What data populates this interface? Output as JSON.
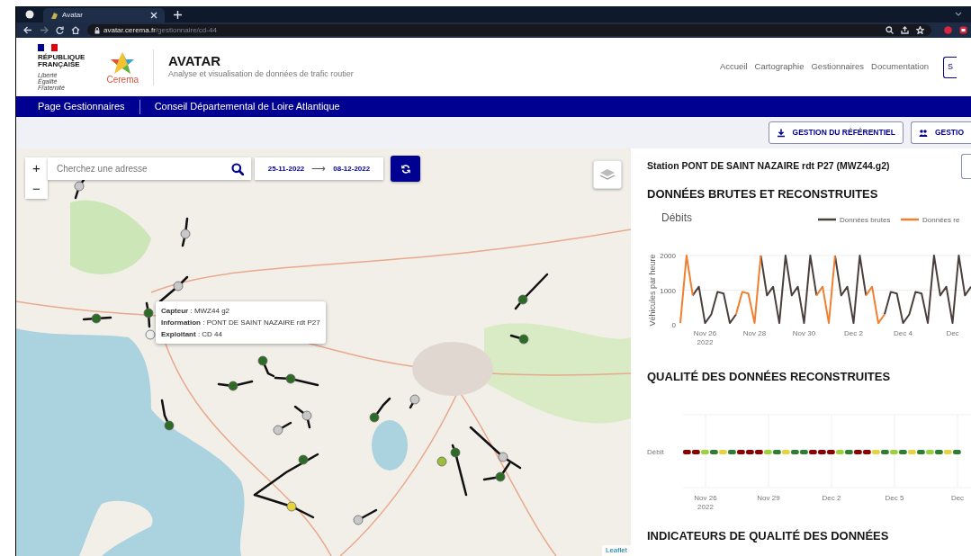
{
  "browser": {
    "tab_title": "Avatar",
    "url_host": "avatar.cerema.fr",
    "url_path": "/gestionnaire/cd-44"
  },
  "header": {
    "logo_lines": [
      "RÉPUBLIQUE",
      "FRANÇAISE"
    ],
    "motto": [
      "Liberté",
      "Égalité",
      "Fraternité"
    ],
    "partner": "Cerema",
    "title": "AVATAR",
    "subtitle": "Analyse et visualisation de données de trafic routier",
    "nav": [
      "Accueil",
      "Cartographie",
      "Gestionnaires",
      "Documentation"
    ],
    "nav_button": "S"
  },
  "breadcrumb": [
    "Page Gestionnaires",
    "Conseil Départemental de Loire Atlantique"
  ],
  "toolbar": [
    {
      "label": "GESTION DU RÉFÉRENTIEL",
      "kind": "download"
    },
    {
      "label": "GESTIO",
      "kind": "users"
    }
  ],
  "map": {
    "zoom_in": "+",
    "zoom_out": "−",
    "search_placeholder": "Cherchez une adresse",
    "date_from": "25-11-2022",
    "date_arrow": "⟶",
    "date_to": "08-12-2022",
    "tooltip": [
      "**Capteur** : MWZ44 g2",
      "**Information** : PONT DE SAINT NAZAIRE rdt P27",
      "**Exploitant** : CD 44"
    ],
    "attribution": "Leaflet",
    "sensors": [
      {
        "color": "#c8c8c8"
      },
      {
        "color": "#c8c8c8"
      },
      {
        "color": "#c8c8c8"
      },
      {
        "color": "#2e6b27"
      },
      {
        "color": "#2e6b27"
      },
      {
        "color": "#eeeeee"
      },
      {
        "color": "#2e6b27"
      },
      {
        "color": "#2e6b27"
      },
      {
        "color": "#2e6b27"
      },
      {
        "color": "#2e6b27"
      },
      {
        "color": "#c8c8c8"
      },
      {
        "color": "#c8c8c8"
      },
      {
        "color": "#2e6b27"
      },
      {
        "color": "#c8c8c8"
      },
      {
        "color": "#2e6b27"
      },
      {
        "color": "#e6d33f"
      },
      {
        "color": "#c8c8c8"
      },
      {
        "color": "#9bbf3a"
      },
      {
        "color": "#2e6b27"
      },
      {
        "color": "#c8c8c8"
      },
      {
        "color": "#2e6b27"
      },
      {
        "color": "#2e6b27"
      },
      {
        "color": "#2e6b27"
      }
    ]
  },
  "station": {
    "title": "Station PONT DE SAINT NAZAIRE rdt P27 (MWZ44.g2)",
    "section_1": "DONNÉES BRUTES ET RECONSTRUITES",
    "chart_data": {
      "type": "line",
      "title": "Débits",
      "ylabel": "Véhicules par heure",
      "categories": [
        null,
        null,
        null,
        null,
        "Nov 26\n2022",
        null,
        null,
        null,
        null,
        null,
        null,
        null,
        "Nov 28",
        null,
        null,
        null,
        null,
        null,
        null,
        null,
        "Nov 30",
        null,
        null,
        null,
        null,
        null,
        null,
        null,
        "Dec 2",
        null,
        null,
        null,
        null,
        null,
        null,
        null,
        "Dec 4",
        null,
        null,
        null,
        null,
        null,
        null,
        null,
        "Dec",
        null,
        null,
        null
      ],
      "series": [
        {
          "name": "Données brutes",
          "color": "#4a3f3c",
          "values": [
            null,
            null,
            850,
            1100,
            50,
            300,
            950,
            900,
            50,
            300,
            null,
            null,
            null,
            2000,
            850,
            1100,
            50,
            2000,
            850,
            1100,
            50,
            2000,
            850,
            null,
            null,
            2000,
            850,
            1100,
            50,
            2000,
            850,
            null,
            null,
            300,
            950,
            900,
            50,
            300,
            950,
            900,
            50,
            2000,
            850,
            1100,
            50,
            2000,
            850,
            1100
          ]
        },
        {
          "name": "Données re",
          "color": "#f07f30",
          "values": [
            50,
            2000,
            850,
            null,
            null,
            null,
            null,
            null,
            null,
            300,
            950,
            900,
            50,
            2000,
            null,
            null,
            null,
            null,
            null,
            null,
            null,
            null,
            850,
            1100,
            50,
            2000,
            null,
            null,
            null,
            null,
            850,
            1100,
            50,
            300,
            null,
            null,
            null,
            null,
            null,
            null,
            null,
            null,
            null,
            null,
            null,
            null,
            null,
            null
          ]
        }
      ],
      "legend": "top-right",
      "ylim": [
        0,
        2000
      ],
      "yticks": [
        0,
        1000,
        2000
      ]
    },
    "section_2": "QUALITÉ DES DONNÉES RECONSTRUITES",
    "quality": {
      "row_label": "Débit",
      "x_labels": [
        "Nov 26\n2022",
        "Nov 29",
        "Dec 2",
        "Dec 5",
        "Dec"
      ],
      "segments": [
        {
          "color": "#8b0000"
        },
        {
          "color": "#8b0000"
        },
        {
          "color": "#9bd13a"
        },
        {
          "color": "#2e7d32"
        },
        {
          "color": "#e6d33f"
        },
        {
          "color": "#2e7d32"
        },
        {
          "color": "#8b0000"
        },
        {
          "color": "#8b0000"
        },
        {
          "color": "#8b0000"
        },
        {
          "color": "#9bd13a"
        },
        {
          "color": "#2e7d32"
        },
        {
          "color": "#e6d33f"
        },
        {
          "color": "#2e7d32"
        },
        {
          "color": "#2e7d32"
        },
        {
          "color": "#8b0000"
        },
        {
          "color": "#8b0000"
        },
        {
          "color": "#8b0000"
        },
        {
          "color": "#9bd13a"
        },
        {
          "color": "#2e7d32"
        },
        {
          "color": "#8b0000"
        },
        {
          "color": "#8b0000"
        },
        {
          "color": "#e6d33f"
        },
        {
          "color": "#2e7d32"
        },
        {
          "color": "#9bd13a"
        },
        {
          "color": "#2e7d32"
        },
        {
          "color": "#e6d33f"
        },
        {
          "color": "#2e7d32"
        },
        {
          "color": "#9bd13a"
        },
        {
          "color": "#2e7d32"
        },
        {
          "color": "#e6d33f"
        },
        {
          "color": "#2e7d32"
        }
      ]
    },
    "section_3": "INDICATEURS DE QUALITÉ DES DONNÉES"
  }
}
